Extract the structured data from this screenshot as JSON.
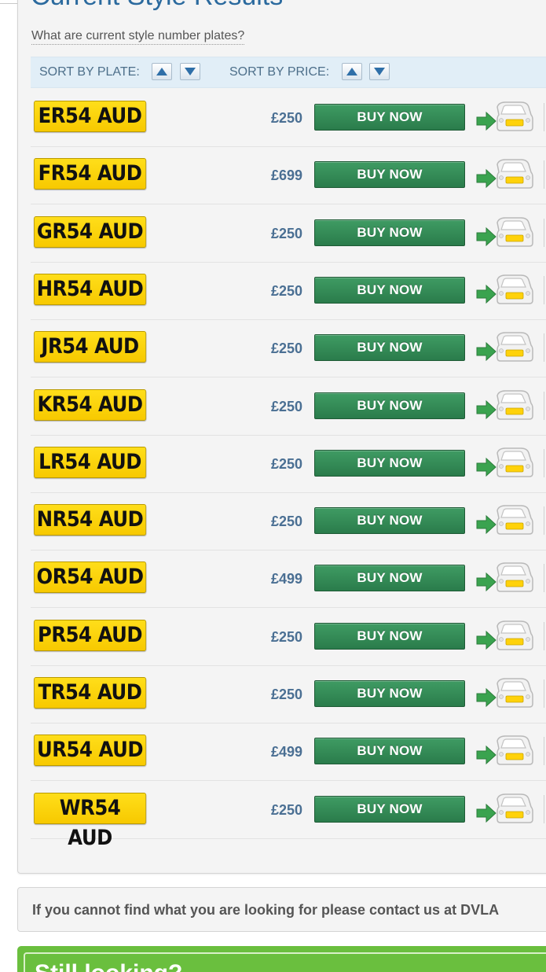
{
  "section": {
    "title": "Current Style Results",
    "help_link": "What are current style number plates?"
  },
  "sort": {
    "plate_label": "SORT BY PLATE:",
    "price_label": "SORT BY PRICE:"
  },
  "results": [
    {
      "plate": "ER54 AUD",
      "price": "£250",
      "buy_label": "BUY NOW"
    },
    {
      "plate": "FR54 AUD",
      "price": "£699",
      "buy_label": "BUY NOW"
    },
    {
      "plate": "GR54 AUD",
      "price": "£250",
      "buy_label": "BUY NOW"
    },
    {
      "plate": "HR54 AUD",
      "price": "£250",
      "buy_label": "BUY NOW"
    },
    {
      "plate": "JR54 AUD",
      "price": "£250",
      "buy_label": "BUY NOW"
    },
    {
      "plate": "KR54 AUD",
      "price": "£250",
      "buy_label": "BUY NOW"
    },
    {
      "plate": "LR54 AUD",
      "price": "£250",
      "buy_label": "BUY NOW"
    },
    {
      "plate": "NR54 AUD",
      "price": "£250",
      "buy_label": "BUY NOW"
    },
    {
      "plate": "OR54 AUD",
      "price": "£499",
      "buy_label": "BUY NOW"
    },
    {
      "plate": "PR54 AUD",
      "price": "£250",
      "buy_label": "BUY NOW"
    },
    {
      "plate": "TR54 AUD",
      "price": "£250",
      "buy_label": "BUY NOW"
    },
    {
      "plate": "UR54 AUD",
      "price": "£499",
      "buy_label": "BUY NOW"
    },
    {
      "plate": "WR54 AUD",
      "price": "£250",
      "buy_label": "BUY NOW"
    }
  ],
  "contact": {
    "text": "If you cannot find what you are looking for please contact us at DVLA"
  },
  "still_looking": {
    "title": "Still looking?"
  },
  "colors": {
    "plate_yellow": "#ffd60a",
    "buy_green": "#2e8553",
    "price_blue": "#4a6f93",
    "sort_bar_bg": "#e1eef7",
    "still_green": "#6abf3e"
  },
  "icons": {
    "sort_up": "triangle-up-icon",
    "sort_down": "triangle-down-icon",
    "preview": "car-preview-icon"
  }
}
